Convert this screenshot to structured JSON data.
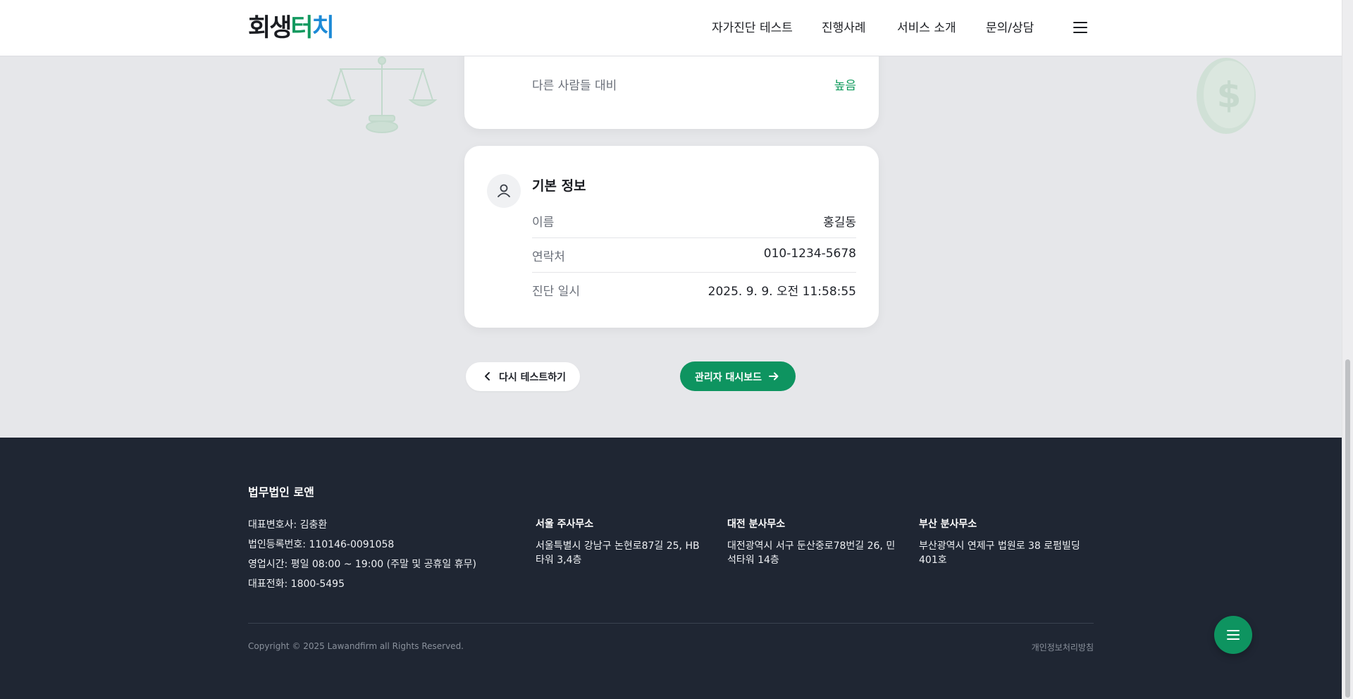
{
  "header": {
    "logo": {
      "part1": "회생",
      "part2": "터",
      "part3": "치"
    },
    "nav": [
      {
        "label": "자가진단 테스트"
      },
      {
        "label": "진행사례"
      },
      {
        "label": "서비스 소개"
      },
      {
        "label": "문의/상담"
      }
    ]
  },
  "result_card": {
    "rows": [
      {
        "label": "다른 사람들 대비",
        "value": "높음"
      }
    ]
  },
  "basic_info": {
    "title": "기본 정보",
    "rows": [
      {
        "label": "이름",
        "value": "홍길동"
      },
      {
        "label": "연락처",
        "value": "010-1234-5678"
      },
      {
        "label": "진단 일시",
        "value": "2025. 9. 9. 오전 11:58:55"
      }
    ]
  },
  "actions": {
    "retry_label": "다시 테스트하기",
    "admin_label": "관리자 대시보드"
  },
  "footer": {
    "company": "법무법인 로앤",
    "info": [
      "대표변호사: 김충환",
      "법인등록번호: 110146-0091058",
      "영업시간: 평일 08:00 ~ 19:00 (주말 및 공휴일 휴무)",
      "대표전화: 1800-5495"
    ],
    "offices": [
      {
        "title": "서울 주사무소",
        "address": "서울특별시 강남구 논현로87길 25, HB타워 3,4층"
      },
      {
        "title": "대전 분사무소",
        "address": "대전광역시 서구 둔산중로78번길 26, 민석타워 14층"
      },
      {
        "title": "부산 분사무소",
        "address": "부산광역시 연제구 법원로 38 로펌빌딩 401호"
      }
    ],
    "copyright": "Copyright © 2025 Lawandfirm all Rights Reserved.",
    "privacy": "개인정보처리방침"
  },
  "colors": {
    "brand_green": "#0e9460",
    "accent_blue": "#1c8ad6",
    "footer_bg": "#1f2633"
  }
}
